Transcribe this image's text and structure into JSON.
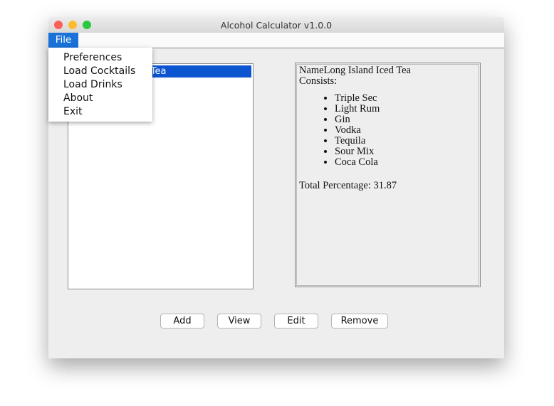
{
  "window": {
    "title": "Alcohol Calculator v1.0.0"
  },
  "menubar": {
    "file": "File"
  },
  "file_menu": [
    "Preferences",
    "Load Cocktails",
    "Load Drinks",
    "About",
    "Exit"
  ],
  "list": {
    "items": [
      "Long Island Iced Tea"
    ],
    "selected_color": "#0b55d0"
  },
  "detail": {
    "name_line": "NameLong Island Iced Tea",
    "consists": "Consists:",
    "ingredients": [
      "Triple Sec",
      "Light Rum",
      "Gin",
      "Vodka",
      "Tequila",
      "Sour Mix",
      "Coca Cola"
    ],
    "total": "Total Percentage: 31.87"
  },
  "buttons": {
    "add": "Add",
    "view": "View",
    "edit": "Edit",
    "remove": "Remove"
  }
}
